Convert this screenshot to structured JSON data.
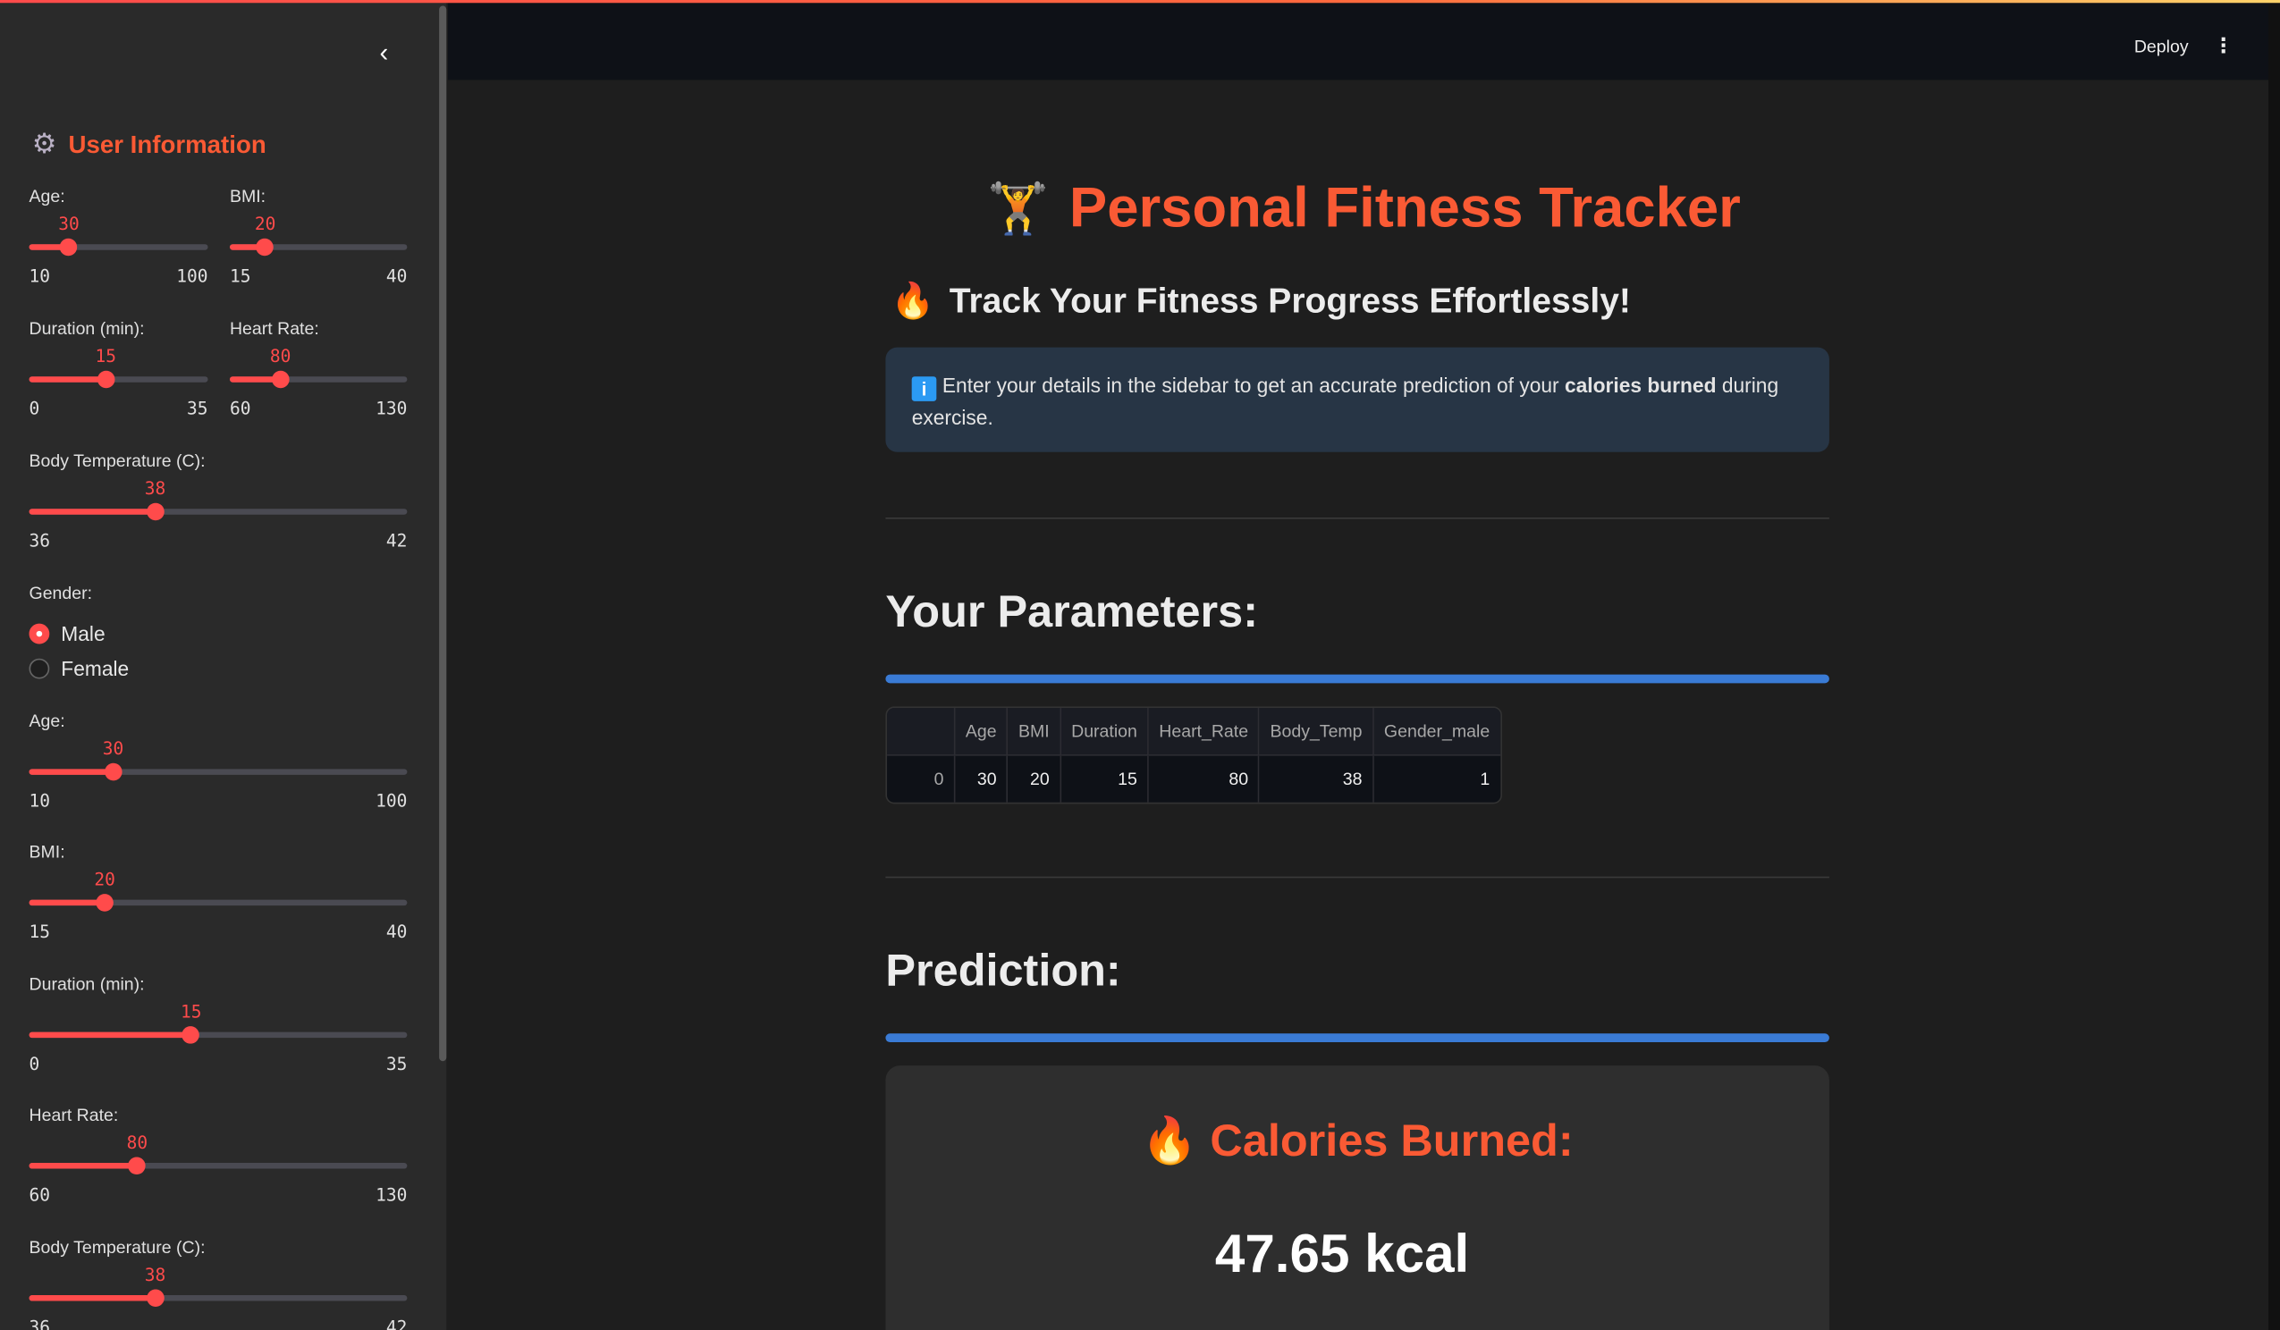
{
  "colors": {
    "accent": "#ff4b4b",
    "title": "#fa5a34",
    "info_bg": "#273545",
    "bar": "#3a7bd5"
  },
  "header": {
    "deploy_label": "Deploy",
    "menu_icon": "kebab-menu-icon"
  },
  "sidebar": {
    "collapse_icon": "chevron-left-icon",
    "title": "User Information",
    "title_icon": "gear-icon",
    "sliders": [
      {
        "label": "Age:",
        "value": 30,
        "min": 10,
        "max": 100
      },
      {
        "label": "BMI:",
        "value": 20,
        "min": 15,
        "max": 40
      },
      {
        "label": "Duration (min):",
        "value": 15,
        "min": 0,
        "max": 35
      },
      {
        "label": "Heart Rate:",
        "value": 80,
        "min": 60,
        "max": 130
      },
      {
        "label": "Body Temperature (C):",
        "value": 38,
        "min": 36,
        "max": 42
      },
      {
        "label": "Age:",
        "value": 30,
        "min": 10,
        "max": 100
      },
      {
        "label": "BMI:",
        "value": 20,
        "min": 15,
        "max": 40
      },
      {
        "label": "Duration (min):",
        "value": 15,
        "min": 0,
        "max": 35
      },
      {
        "label": "Heart Rate:",
        "value": 80,
        "min": 60,
        "max": 130
      },
      {
        "label": "Body Temperature (C):",
        "value": 38,
        "min": 36,
        "max": 42
      }
    ],
    "gender": {
      "label": "Gender:",
      "options": [
        "Male",
        "Female"
      ],
      "selected": "Male"
    }
  },
  "main": {
    "title": "Personal Fitness Tracker",
    "title_emoji": "🏋️",
    "subtitle": "Track Your Fitness Progress Effortlessly!",
    "subtitle_emoji": "🔥",
    "info": {
      "icon": "i",
      "text_before": "Enter your details in the sidebar to get an accurate prediction of your ",
      "text_bold": "calories burned",
      "text_after": " during exercise."
    },
    "params_heading": "Your Parameters:",
    "table": {
      "columns": [
        "",
        "Age",
        "BMI",
        "Duration",
        "Heart_Rate",
        "Body_Temp",
        "Gender_male"
      ],
      "rows": [
        [
          "0",
          "30",
          "20",
          "15",
          "80",
          "38",
          "1"
        ]
      ]
    },
    "prediction_heading": "Prediction:",
    "calories_label": "Calories Burned:",
    "calories_emoji": "🔥",
    "calories_value": "47.65 kcal"
  }
}
